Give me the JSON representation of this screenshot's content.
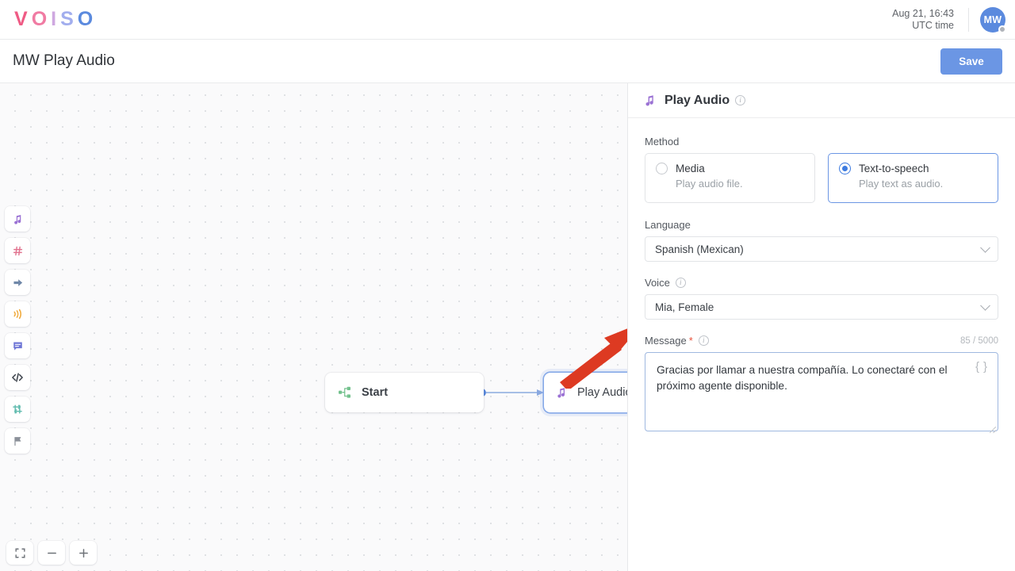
{
  "topbar": {
    "logo_letters": [
      {
        "char": "V",
        "color": "#ef5b85"
      },
      {
        "char": "O",
        "color": "#f07ba3"
      },
      {
        "char": "I",
        "color": "#cfa8e0"
      },
      {
        "char": "S",
        "color": "#a2aeee"
      },
      {
        "char": "O",
        "color": "#5b8ade"
      }
    ],
    "date": "Aug 21, 16:43",
    "timezone": "UTC time",
    "avatar_initials": "MW"
  },
  "titlebar": {
    "title": "MW Play Audio",
    "save_label": "Save"
  },
  "canvas": {
    "rail_tools": [
      {
        "name": "music-note-icon",
        "color": "#9b72d4"
      },
      {
        "name": "hash-icon",
        "color": "#e1738f"
      },
      {
        "name": "arrow-right-icon",
        "color": "#6f87a8"
      },
      {
        "name": "sound-waves-icon",
        "color": "#f0a93a"
      },
      {
        "name": "chat-bubble-icon",
        "color": "#6f76d6"
      },
      {
        "name": "code-brackets-icon",
        "color": "#3a4049"
      },
      {
        "name": "transfer-arrows-icon",
        "color": "#63bdb0"
      },
      {
        "name": "flag-icon",
        "color": "#8b9099"
      }
    ],
    "nodes": [
      {
        "id": "start",
        "label": "Start",
        "icon": "flow-branch-icon",
        "selected": false
      },
      {
        "id": "play-audio",
        "label": "Play Audio",
        "icon": "music-note-icon",
        "selected": true
      }
    ],
    "zoom_controls": [
      {
        "name": "fit-view-button",
        "glyph": "fit"
      },
      {
        "name": "zoom-out-button",
        "glyph": "minus"
      },
      {
        "name": "zoom-in-button",
        "glyph": "plus"
      }
    ],
    "annotation": {
      "name": "red-arrow-annotation",
      "color": "#dd3a22",
      "points_to": "language-select"
    }
  },
  "panel": {
    "header_title": "Play Audio",
    "method": {
      "label": "Method",
      "options": [
        {
          "name": "Media",
          "desc": "Play audio file.",
          "selected": false
        },
        {
          "name": "Text-to-speech",
          "desc": "Play text as audio.",
          "selected": true
        }
      ]
    },
    "language": {
      "label": "Language",
      "value": "Spanish (Mexican)"
    },
    "voice": {
      "label": "Voice",
      "value": "Mia, Female"
    },
    "message": {
      "label": "Message",
      "required_mark": "*",
      "counter": "85 / 5000",
      "value": "Gracias por llamar a nuestra compañía. Lo conectaré con el próximo agente disponible."
    }
  }
}
